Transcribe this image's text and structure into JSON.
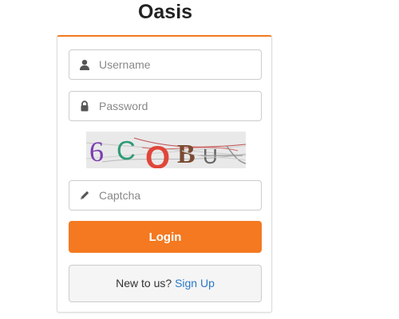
{
  "app_title": "Oasis",
  "login_form": {
    "username": {
      "placeholder": "Username",
      "value": ""
    },
    "password": {
      "placeholder": "Password",
      "value": ""
    },
    "captcha_image_text": "6COBU",
    "captcha": {
      "placeholder": "Captcha",
      "value": ""
    },
    "login_label": "Login",
    "signup_prompt": "New to us?",
    "signup_link": "Sign Up"
  },
  "colors": {
    "accent": "#f47920",
    "link": "#2a7ac7"
  },
  "icons": {
    "username": "user-icon",
    "password": "lock-icon",
    "captcha": "pencil-icon"
  }
}
